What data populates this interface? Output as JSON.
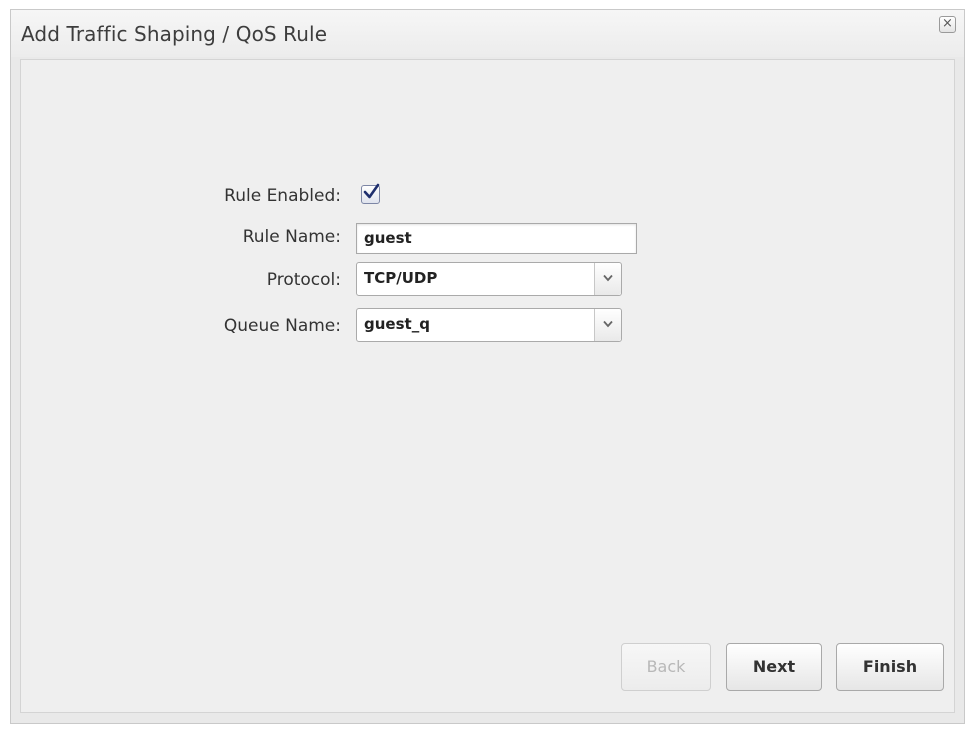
{
  "dialog": {
    "title": "Add Traffic Shaping / QoS Rule",
    "close_label": "×"
  },
  "form": {
    "rule_enabled_label": "Rule Enabled:",
    "rule_enabled_checked": true,
    "rule_name_label": "Rule Name:",
    "rule_name_value": "guest",
    "protocol_label": "Protocol:",
    "protocol_value": "TCP/UDP",
    "queue_name_label": "Queue Name:",
    "queue_name_value": "guest_q"
  },
  "buttons": {
    "back": "Back",
    "next": "Next",
    "finish": "Finish"
  },
  "icons": {
    "close": "close-icon",
    "check": "checkmark-icon",
    "dropdown": "chevron-down-icon"
  },
  "colors": {
    "dialog_bg": "#e9e9e9",
    "content_bg": "#efefef",
    "checkbox_mark": "#1f2f6e"
  }
}
